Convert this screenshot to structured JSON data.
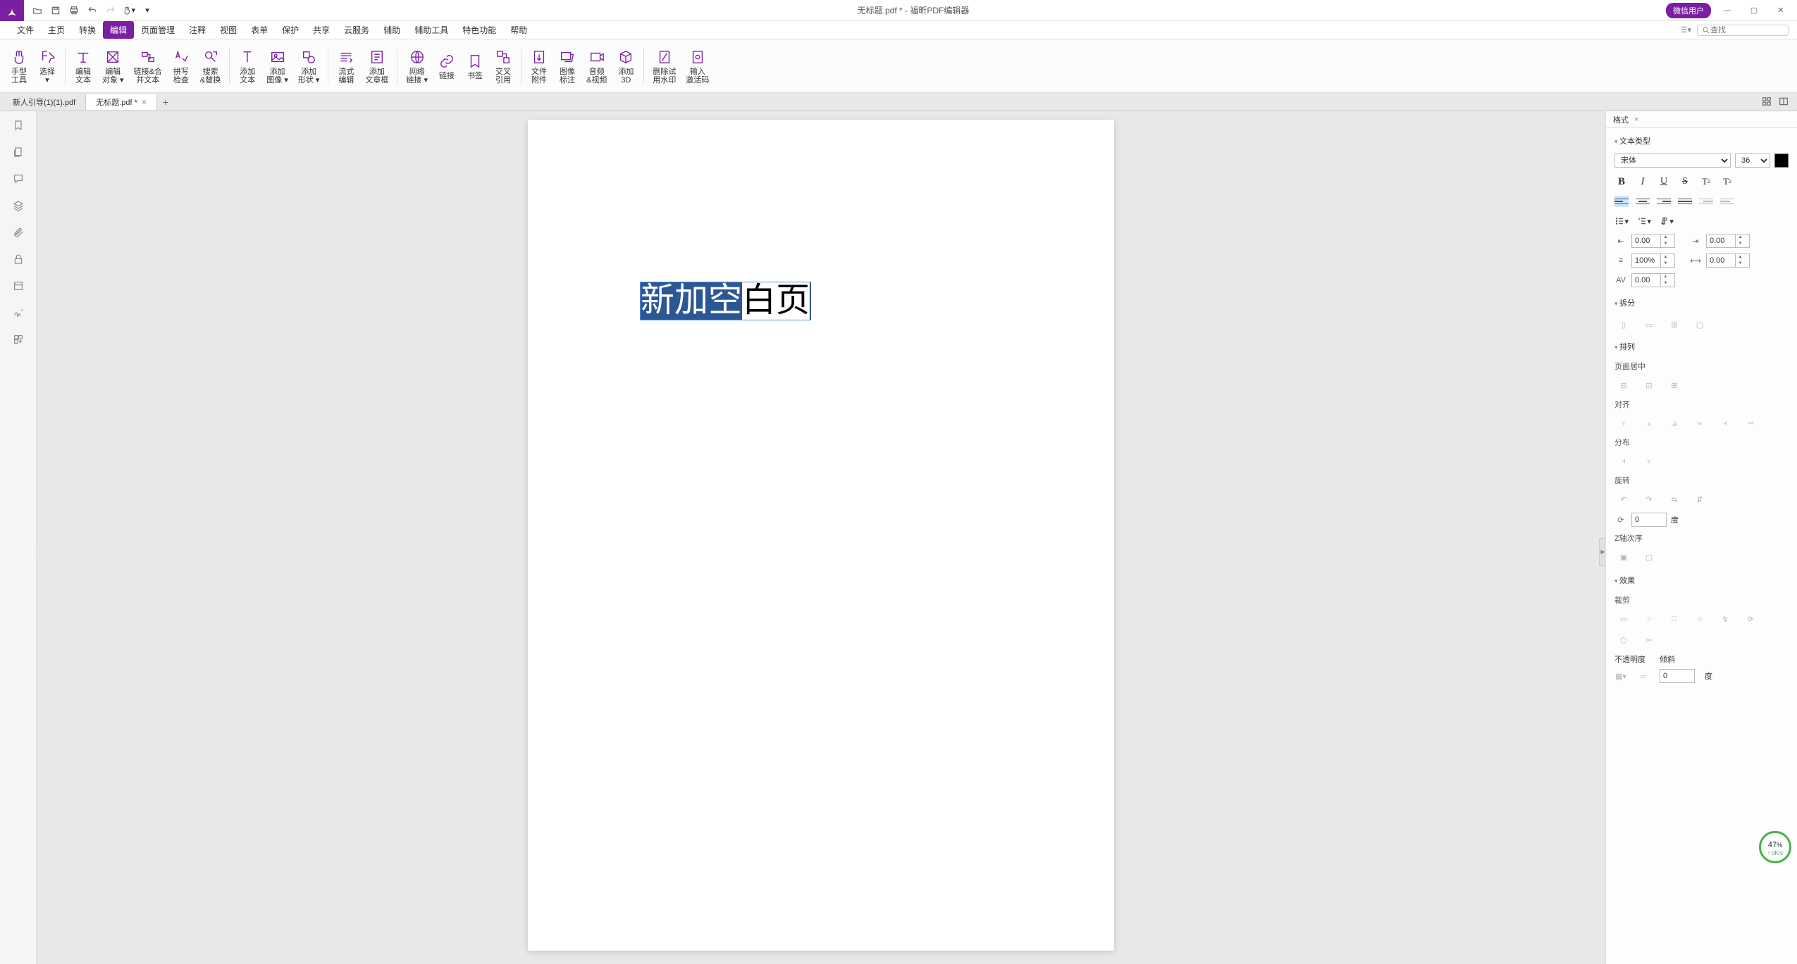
{
  "title": "无标题.pdf * - 福昕PDF编辑器",
  "user_badge": "微信用户",
  "search_placeholder": "查找",
  "menu": [
    "文件",
    "主页",
    "转换",
    "编辑",
    "页面管理",
    "注释",
    "视图",
    "表单",
    "保护",
    "共享",
    "云服务",
    "辅助",
    "辅助工具",
    "特色功能",
    "帮助"
  ],
  "menu_active_index": 3,
  "ribbon": [
    {
      "l1": "手型",
      "l2": "工具"
    },
    {
      "l1": "选择",
      "l2": "▾"
    },
    {
      "l1": "编辑",
      "l2": "文本"
    },
    {
      "l1": "编辑",
      "l2": "对象 ▾"
    },
    {
      "l1": "链接&合",
      "l2": "并文本"
    },
    {
      "l1": "拼写",
      "l2": "检查"
    },
    {
      "l1": "搜索",
      "l2": "&替换"
    },
    {
      "l1": "添加",
      "l2": "文本"
    },
    {
      "l1": "添加",
      "l2": "图像 ▾"
    },
    {
      "l1": "添加",
      "l2": "形状 ▾"
    },
    {
      "l1": "流式",
      "l2": "编辑"
    },
    {
      "l1": "添加",
      "l2": "文章框"
    },
    {
      "l1": "网络",
      "l2": "链接 ▾"
    },
    {
      "l1": "链接",
      "l2": ""
    },
    {
      "l1": "书签",
      "l2": ""
    },
    {
      "l1": "交叉",
      "l2": "引用"
    },
    {
      "l1": "文件",
      "l2": "附件"
    },
    {
      "l1": "图像",
      "l2": "标注"
    },
    {
      "l1": "音频",
      "l2": "&视频"
    },
    {
      "l1": "添加",
      "l2": "3D"
    },
    {
      "l1": "删除试",
      "l2": "用水印"
    },
    {
      "l1": "输入",
      "l2": "激活码"
    }
  ],
  "doc_tabs": [
    {
      "name": "新人引导(1)(1).pdf",
      "active": false
    },
    {
      "name": "无标题.pdf *",
      "active": true
    }
  ],
  "page_text": {
    "selected": "新加空",
    "rest": "白页"
  },
  "rpanel": {
    "tab": "格式",
    "sec_text": "文本类型",
    "font": "宋体",
    "size": "36",
    "indent_left": "0.00",
    "indent_right": "0.00",
    "line_spacing": "100%",
    "char_spacing": "0.00",
    "para_spacing": "0.00",
    "sec_split": "拆分",
    "sec_arrange": "排列",
    "lbl_page_center": "页面居中",
    "lbl_align": "对齐",
    "lbl_distrib": "分布",
    "lbl_rotate": "旋转",
    "rotate_val": "0",
    "rotate_unit": "度",
    "lbl_zorder": "Z轴次序",
    "sec_effect": "效果",
    "lbl_crop": "裁剪",
    "lbl_opacity": "不透明度",
    "lbl_skew": "倾斜",
    "skew_val": "0",
    "skew_unit": "度"
  },
  "perf": {
    "value": "47",
    "pct": "%",
    "unit": "↑ 0K/s"
  }
}
